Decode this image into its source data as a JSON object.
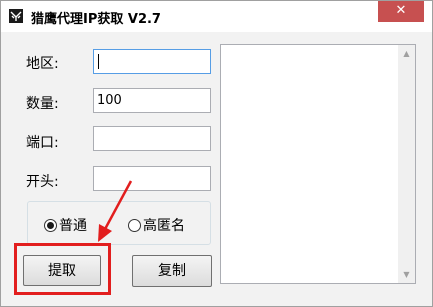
{
  "window": {
    "title": "猎鹰代理IP获取 V2.7",
    "close_glyph": "✕"
  },
  "form": {
    "region": {
      "label": "地区:",
      "value": ""
    },
    "quantity": {
      "label": "数量:",
      "value": "100"
    },
    "port": {
      "label": "端口:",
      "value": ""
    },
    "prefix": {
      "label": "开头:",
      "value": ""
    }
  },
  "mode": {
    "options": [
      "普通",
      "高匿名"
    ],
    "selected": "普通"
  },
  "buttons": {
    "extract": "提取",
    "copy": "复制"
  },
  "output": {
    "text": "",
    "scroll_up_glyph": "▲",
    "scroll_down_glyph": "▼"
  },
  "annotation": {
    "color": "#e21e1e"
  }
}
